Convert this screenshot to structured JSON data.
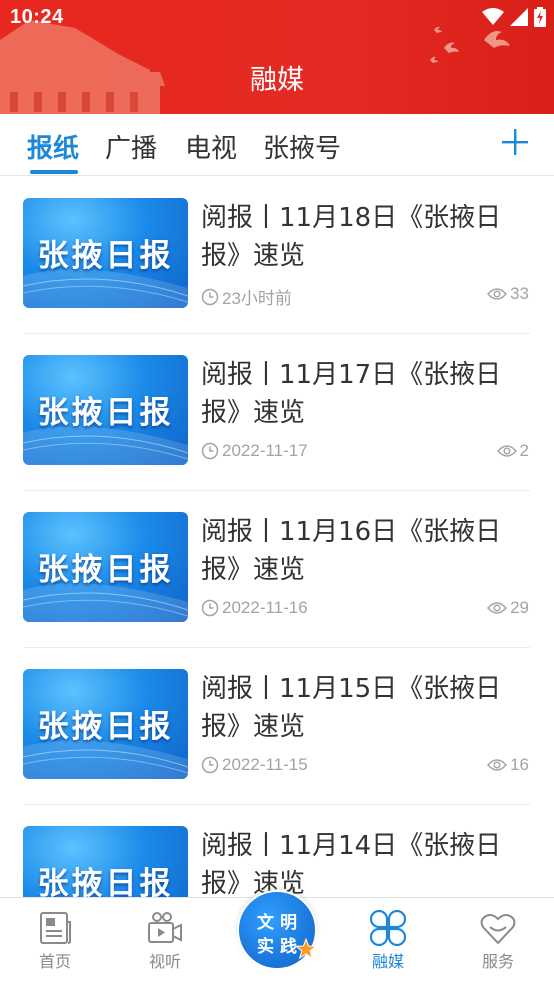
{
  "status_bar": {
    "time": "10:24"
  },
  "header": {
    "title": "融媒"
  },
  "tabs": [
    {
      "label": "报纸",
      "active": true
    },
    {
      "label": "广播",
      "active": false
    },
    {
      "label": "电视",
      "active": false
    },
    {
      "label": "张掖号",
      "active": false
    }
  ],
  "colors": {
    "accent": "#1e88d8",
    "header_red": "#e42a22",
    "meta_gray": "#a3a3a3"
  },
  "news": [
    {
      "thumb_text": "张掖日报",
      "title": "阅报丨11月18日《张掖日报》速览",
      "time": "23小时前",
      "views": "33"
    },
    {
      "thumb_text": "张掖日报",
      "title": "阅报丨11月17日《张掖日报》速览",
      "time": "2022-11-17",
      "views": "2"
    },
    {
      "thumb_text": "张掖日报",
      "title": "阅报丨11月16日《张掖日报》速览",
      "time": "2022-11-16",
      "views": "29"
    },
    {
      "thumb_text": "张掖日报",
      "title": "阅报丨11月15日《张掖日报》速览",
      "time": "2022-11-15",
      "views": "16"
    },
    {
      "thumb_text": "张掖日报",
      "title": "阅报丨11月14日《张掖日报》速览",
      "time": "",
      "views": ""
    }
  ],
  "bottom_nav": {
    "items": [
      {
        "label": "首页",
        "icon": "newspaper-icon"
      },
      {
        "label": "视听",
        "icon": "video-camera-icon"
      },
      {
        "label": "融媒",
        "icon": "clover-grid-icon",
        "active": true
      },
      {
        "label": "服务",
        "icon": "heart-service-icon"
      }
    ],
    "center_badge": {
      "line1": "文明",
      "line2": "实践"
    }
  }
}
